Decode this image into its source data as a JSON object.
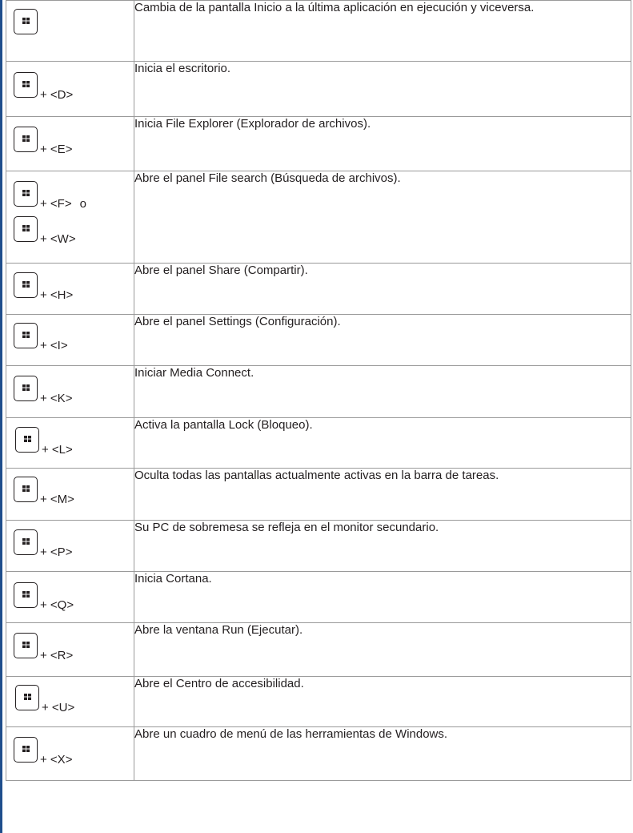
{
  "table": {
    "rows": [
      {
        "keys": [
          {
            "suffix": ""
          }
        ],
        "description": "Cambia de la pantalla Inicio a la última aplicación en ejecución y viceversa."
      },
      {
        "keys": [
          {
            "suffix": "+ <D>"
          }
        ],
        "description": "Inicia el escritorio."
      },
      {
        "keys": [
          {
            "suffix": "+ <E>"
          }
        ],
        "description": "Inicia File Explorer (Explorador de archivos)."
      },
      {
        "keys": [
          {
            "suffix": "+ <F>",
            "separator": "o"
          },
          {
            "suffix": "+ <W>"
          }
        ],
        "description": "Abre el panel File search (Búsqueda de archivos)."
      },
      {
        "keys": [
          {
            "suffix": "+ <H>"
          }
        ],
        "description": "Abre el panel Share (Compartir)."
      },
      {
        "keys": [
          {
            "suffix": "+ <I>"
          }
        ],
        "description": "Abre el panel Settings (Configuración)."
      },
      {
        "keys": [
          {
            "suffix": "+ <K>"
          }
        ],
        "description": "Iniciar Media Connect."
      },
      {
        "keys": [
          {
            "suffix": "+ <L>"
          }
        ],
        "description": "Activa la pantalla Lock (Bloqueo)."
      },
      {
        "keys": [
          {
            "suffix": "+ <M>"
          }
        ],
        "description": "Oculta todas las pantallas actualmente activas en la barra de tareas."
      },
      {
        "keys": [
          {
            "suffix": "+ <P>"
          }
        ],
        "description": "Su PC de sobremesa se refleja en el monitor secundario."
      },
      {
        "keys": [
          {
            "suffix": "+ <Q>"
          }
        ],
        "description": "Inicia Cortana."
      },
      {
        "keys": [
          {
            "suffix": "+ <R>"
          }
        ],
        "description": "Abre la ventana Run (Ejecutar)."
      },
      {
        "keys": [
          {
            "suffix": "+ <U>"
          }
        ],
        "description": "Abre el Centro de accesibilidad."
      },
      {
        "keys": [
          {
            "suffix": "+ <X>"
          }
        ],
        "description": "Abre un cuadro de menú de las herramientas de Windows."
      }
    ]
  },
  "icons": {
    "windows_key": "windows-logo-icon"
  },
  "colors": {
    "edge_line": "#1f4e8c",
    "text": "#231f20",
    "grid": "#9a9a9a"
  }
}
